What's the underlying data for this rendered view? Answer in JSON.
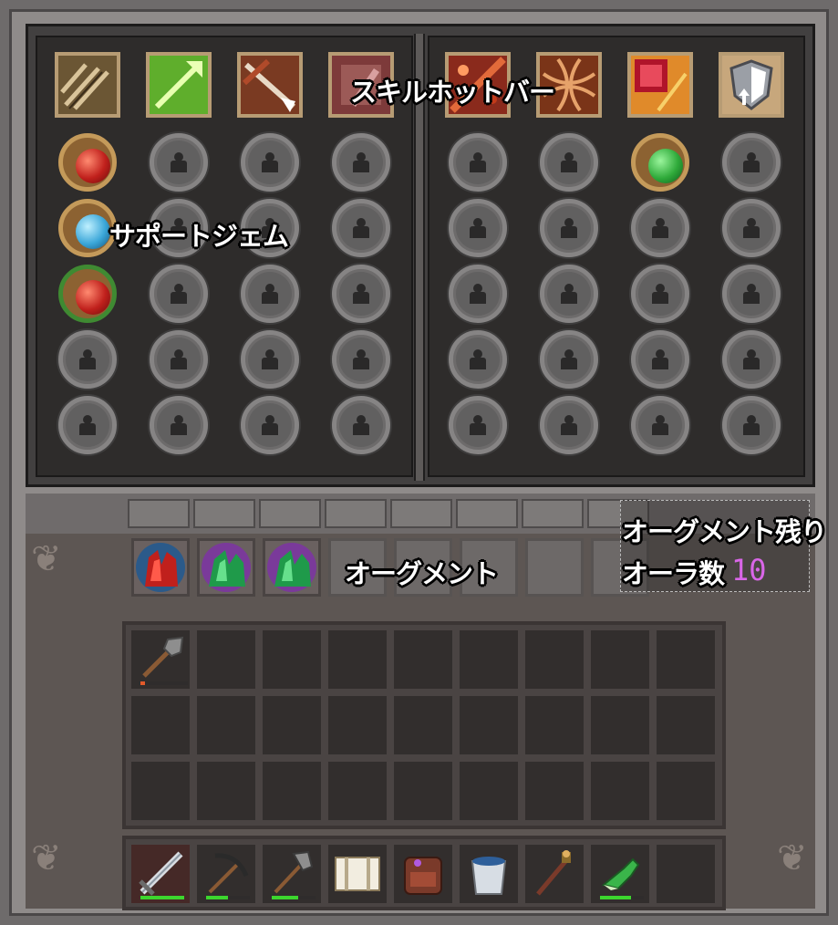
{
  "labels": {
    "skill_hotbar": "スキルホットバー",
    "support_gem": "サポートジェム",
    "augment": "オーグメント",
    "augment_remaining": "オーグメント残り",
    "aura_count": "オーラ数",
    "aura_count_value": "10"
  },
  "skills": {
    "left": [
      "multi-arrow-skill-icon",
      "green-arrow-skill-icon",
      "piercing-arrow-skill-icon",
      "red-blade-skill-icon"
    ],
    "right": [
      "fire-slash-skill-icon",
      "burst-skill-icon",
      "crimson-strike-skill-icon",
      "shield-up-skill-icon"
    ]
  },
  "colors": {
    "gem_red": "#c0201c",
    "gem_blue": "#3aa6d8",
    "gem_green": "#2faa3a",
    "augment_value": "#d966e8",
    "durability": "#3cd62e"
  },
  "augments": [
    "red-crystal-augment-icon",
    "green-crystal-augment-icon",
    "green-crystal-augment-icon"
  ],
  "inventory": [
    "shovel-icon"
  ],
  "hotbar": [
    "sword-icon",
    "pickaxe-icon",
    "axe-icon",
    "paper-scroll-icon",
    "backpack-icon",
    "water-bucket-icon",
    "torch-staff-icon",
    "green-boots-icon"
  ],
  "durability": {
    "shovel": 0.1,
    "sword": 1.0,
    "pickaxe": 0.5,
    "axe": 0.6,
    "boots": 0.7
  }
}
